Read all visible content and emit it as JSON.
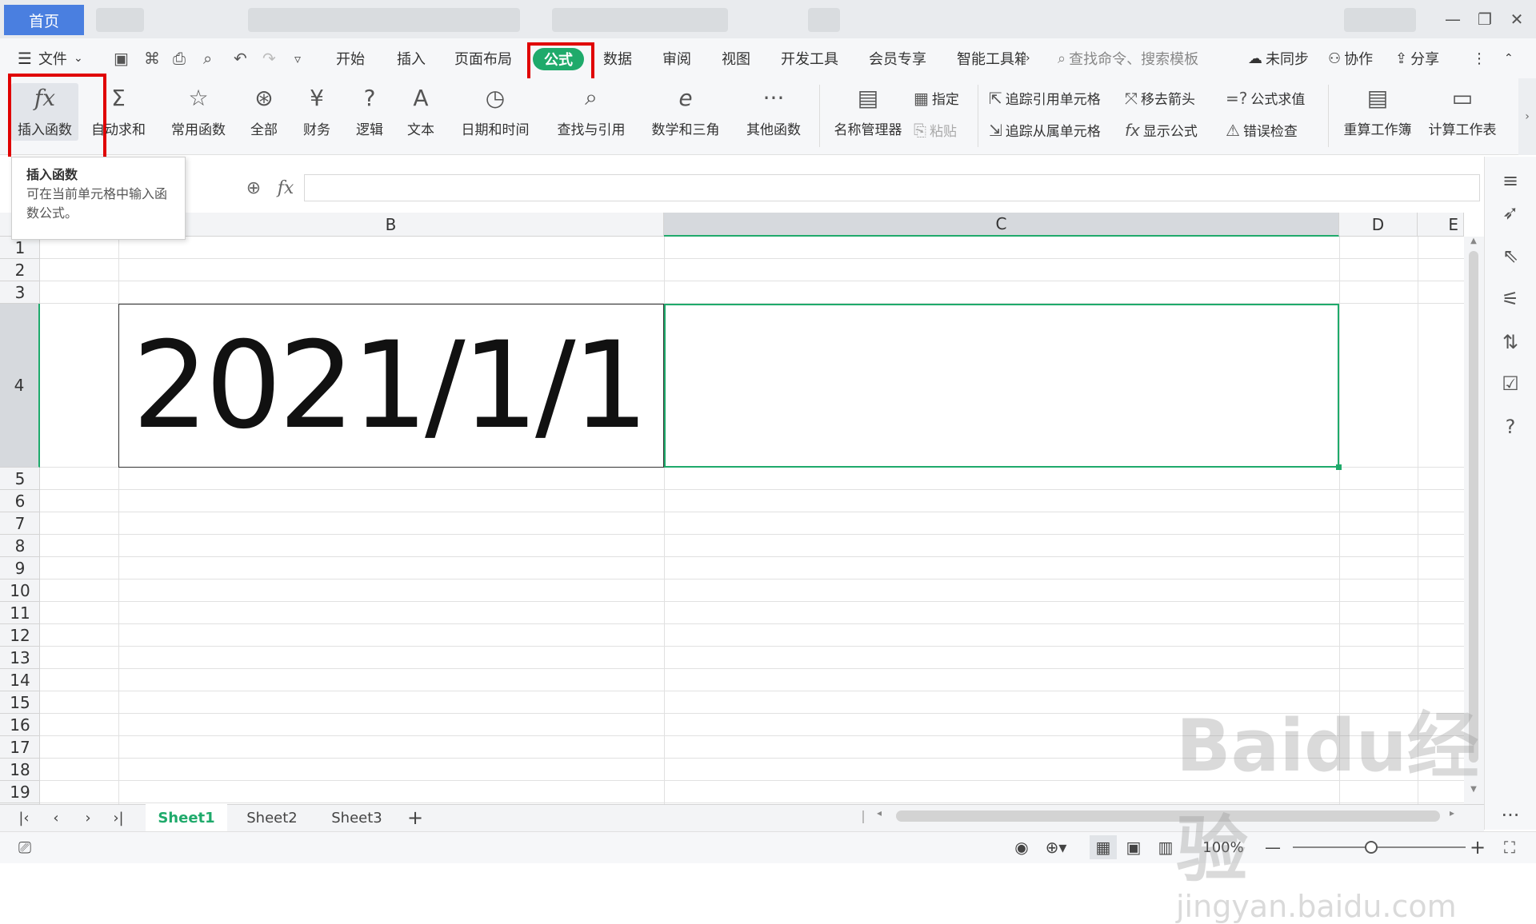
{
  "titlebar": {
    "home_tab": "首页",
    "min": "—",
    "restore": "❐",
    "close": "✕"
  },
  "menu": {
    "file": "文件",
    "items": [
      "开始",
      "插入",
      "页面布局",
      "公式",
      "数据",
      "审阅",
      "视图",
      "开发工具",
      "会员专享",
      "智能工具箱"
    ],
    "search_placeholder": "查找命令、搜索模板",
    "sync": "未同步",
    "collab": "协作",
    "share": "分享"
  },
  "ribbon": {
    "insert_function": "插入函数",
    "autosum": "自动求和",
    "common": "常用函数",
    "all": "全部",
    "finance": "财务",
    "logic": "逻辑",
    "text": "文本",
    "datetime": "日期和时间",
    "lookup": "查找与引用",
    "math": "数学和三角",
    "other": "其他函数",
    "name_manager": "名称管理器",
    "assign": "指定",
    "paste": "粘贴",
    "trace_precedents": "追踪引用单元格",
    "trace_dependents": "追踪从属单元格",
    "remove_arrows": "移去箭头",
    "show_formula": "显示公式",
    "eval_formula": "公式求值",
    "error_check": "错误检查",
    "recalc_workbook": "重算工作簿",
    "calc_sheet": "计算工作表"
  },
  "tooltip": {
    "title": "插入函数",
    "body": "可在当前单元格中输入函数公式。"
  },
  "formula_bar": {
    "fx": "fx",
    "value": ""
  },
  "grid": {
    "columns": [
      "B",
      "C",
      "D",
      "E"
    ],
    "rows": [
      "1",
      "2",
      "3",
      "4",
      "5",
      "6",
      "7",
      "8",
      "9",
      "10",
      "11",
      "12",
      "13",
      "14",
      "15",
      "16",
      "17",
      "18",
      "19"
    ],
    "cell_B4": "2021/1/1",
    "selected_cell": "C4"
  },
  "sheets": [
    "Sheet1",
    "Sheet2",
    "Sheet3"
  ],
  "active_sheet": "Sheet1",
  "status": {
    "zoom": "100%"
  },
  "watermark": {
    "text": "Baidu经验",
    "sub": "jingyan.baidu.com"
  },
  "colors": {
    "accent": "#1faa6b",
    "highlight": "#e00000",
    "home_tab": "#4a7fe0"
  }
}
